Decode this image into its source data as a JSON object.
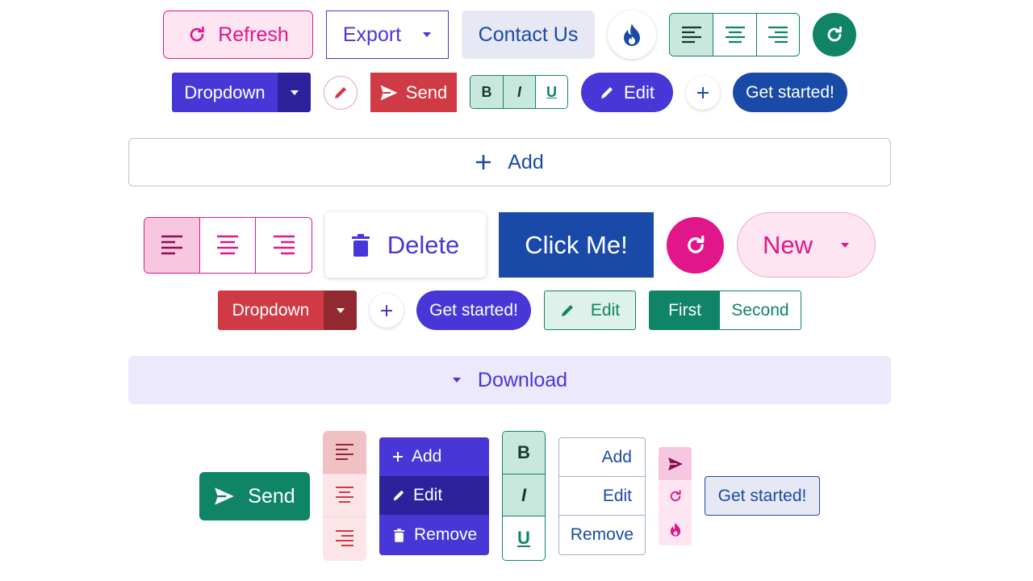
{
  "row1": {
    "refresh_label": "Refresh",
    "export_label": "Export",
    "contact_label": "Contact Us"
  },
  "row2": {
    "dropdown_label": "Dropdown",
    "send_label": "Send",
    "format_bold": "B",
    "format_italic": "I",
    "format_underline": "U",
    "edit_label": "Edit",
    "get_started_label": "Get started!"
  },
  "add_bar": {
    "label": "Add"
  },
  "row3": {
    "delete_label": "Delete",
    "click_me_label": "Click Me!",
    "new_label": "New"
  },
  "row4": {
    "dropdown_label": "Dropdown",
    "get_started_label": "Get started!",
    "edit_label": "Edit",
    "first_label": "First",
    "second_label": "Second"
  },
  "download_bar": {
    "label": "Download"
  },
  "row5": {
    "send_label": "Send",
    "menu_add": "Add",
    "menu_edit": "Edit",
    "menu_remove": "Remove",
    "format_bold": "B",
    "format_italic": "I",
    "format_underline": "U",
    "list_add": "Add",
    "list_edit": "Edit",
    "list_remove": "Remove",
    "get_started_label": "Get started!"
  },
  "colors": {
    "pink": "#e0168a",
    "pink_light": "#fde6f2",
    "indigo": "#4836d6",
    "navy": "#1a4aa8",
    "green": "#0f8466",
    "green_light": "#c9e8dd",
    "red": "#cf3a45",
    "lavender": "#ebe9fb"
  }
}
